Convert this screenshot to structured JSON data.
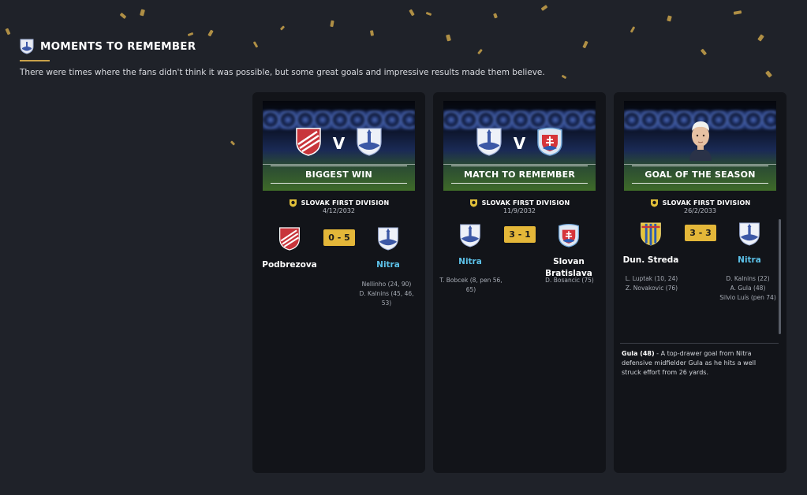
{
  "header": {
    "title": "MOMENTS TO REMEMBER",
    "subtitle": "There were times where the fans didn't think it was possible, but some great goals and impressive results made them believe."
  },
  "colors": {
    "accent": "#c9a24a",
    "score_badge": "#e4b739",
    "nitra": "#5cc1e8",
    "card_bg": "#121419",
    "page_bg": "#1f2229"
  },
  "cards": [
    {
      "banner_label": "BIGGEST WIN",
      "vs": "V",
      "competition": "SLOVAK FIRST DIVISION",
      "date": "4/12/2032",
      "home": {
        "name": "Podbrezova",
        "crest": "podbrezova-crest-icon",
        "scorers": []
      },
      "away": {
        "name": "Nitra",
        "crest": "nitra-crest-icon",
        "scorers": [
          "Nellinho (24, 90)",
          "D. Kalnins (45, 46,",
          "53)"
        ]
      },
      "score": "0 - 5"
    },
    {
      "banner_label": "MATCH TO REMEMBER",
      "vs": "V",
      "competition": "SLOVAK FIRST DIVISION",
      "date": "11/9/2032",
      "home": {
        "name": "Nitra",
        "crest": "nitra-crest-icon",
        "scorers": [
          "T. Bobcek (8, pen 56,",
          "65)"
        ]
      },
      "away": {
        "name_line1": "Slovan",
        "name_line2": "Bratislava",
        "crest": "slovan-bratislava-crest-icon",
        "scorers": [
          "D. Bosancic (75)"
        ]
      },
      "score": "3 - 1"
    },
    {
      "banner_label": "GOAL OF THE SEASON",
      "competition": "SLOVAK FIRST DIVISION",
      "date": "26/2/2033",
      "home": {
        "name": "Dun. Streda",
        "crest": "dunajska-streda-crest-icon",
        "scorers": [
          "L. Luptak (10, 24)",
          "Z. Novakovic (76)"
        ]
      },
      "away": {
        "name": "Nitra",
        "crest": "nitra-crest-icon",
        "scorers": [
          "D. Kalnins (22)",
          "A. Gula (48)",
          "Silvio Luís (pen 74)"
        ]
      },
      "score": "3 - 3",
      "goal_scorer": "Gula (48)",
      "goal_description": " - A top-drawer goal from Nitra defensive midfielder Gula as he hits a well struck effort from 26 yards."
    }
  ]
}
